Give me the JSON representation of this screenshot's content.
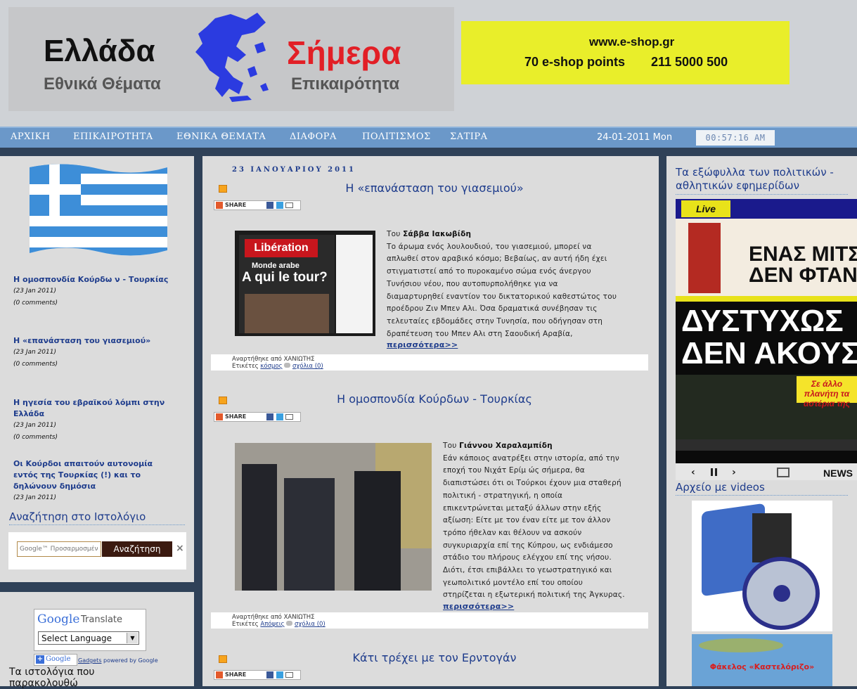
{
  "header": {
    "logo_word1": "Ελλάδα",
    "logo_word2": "Εθνικά Θέματα",
    "logo_word3": "Σήμερα",
    "logo_word4": "Επικαιρότητα",
    "ad_url": "www.e-shop.gr",
    "ad_points": "70 e-shop points",
    "ad_phone": "211 5000 500"
  },
  "nav": {
    "items": [
      "ΑΡΧΙΚΗ",
      "ΕΠΙΚΑΙΡΟΤΗΤΑ",
      "ΕΘΝΙΚΑ ΘΕΜΑΤΑ",
      "ΔΙΑΦΟΡΑ",
      "ΠΟΛΙΤΙΣΜΟΣ",
      "ΣΑΤΙΡΑ"
    ],
    "date": "24-01-2011  Mon",
    "clock": "00:57:16  AM"
  },
  "recent_posts": [
    {
      "title": "Η ομοσπονδία Κούρδω ν - Τουρκίας",
      "date": "(23 Jan 2011)",
      "comments": "(0 comments)"
    },
    {
      "title": "Η «επανάσταση του γιασεμιού»",
      "date": "(23 Jan 2011)",
      "comments": "(0 comments)"
    },
    {
      "title": "Η ηγεσία του εβραϊκού λόμπι στην Ελλάδα",
      "date": "(23 Jan 2011)",
      "comments": "(0 comments)"
    },
    {
      "title": "Οι Κούρδοι απαιτούν αυτονομία εντός της Τουρκίας (!) και το δηλώνουν δημόσια",
      "date": "(23 Jan 2011)"
    }
  ],
  "search_widget": {
    "title": "Αναζήτηση στο Ιστολόγιο",
    "placeholder": "Google™ Προσαρμοσμένη",
    "button": "Αναζήτηση",
    "close": "×"
  },
  "translate_widget": {
    "google": "Google",
    "translate": "Translate",
    "select": "Select Language",
    "gadgets": "Gadgets",
    "powered": "powered by Google"
  },
  "blogs_widget": {
    "title": "Τα ιστολόγια που παρακολουθώ"
  },
  "center": {
    "date_header": "23 ΙΑΝΟΥΑΡΙΟΥ 2011",
    "share_label": "SHARE",
    "posts": [
      {
        "title": "Η «επανάσταση του γιασεμιού»",
        "author_prefix": "Του ",
        "author": "Σάββα Ιακωβίδη",
        "lines": [
          "Το άρωμα ενός λουλουδιού, του γιασεμιού, μπορεί να",
          "απλωθεί στον αραβικό κόσμο; Βεβαίως, αν αυτή ήδη έχει",
          "στιγματιστεί από το πυροκαμένο σώμα ενός άνεργου",
          "Τυνήσιου νέου, που αυτοπυρπολήθηκε για να",
          "διαμαρτυρηθεί εναντίον του δικτατορικού καθεστώτος του",
          "προέδρου Ζιν Μπεν Αλι. Όσα δραματικά συνέβησαν τις",
          "τελευταίες εβδομάδες στην Τυνησία, που οδήγησαν στη",
          "δραπέτευση του Μπεν Αλι στη Σαουδική Αραβία,"
        ],
        "more": "περισσότερα>>",
        "posted_by": "Αναρτήθηκε από ΧΑΝΙΩΤΗΣ",
        "tags_label": "Ετικέτες",
        "tag": "κόσμος",
        "comments": "σχόλια (0)",
        "cover_title": "Libération",
        "cover_sub": "Monde arabe",
        "cover_head": "A qui le tour?"
      },
      {
        "title": "Η ομοσπονδία Κούρδων - Τουρκίας",
        "author_prefix": "Του ",
        "author": "Γιάννου Χαραλαμπίδη",
        "lines": [
          "Εάν κάποιος ανατρέξει στην ιστορία, από την",
          "εποχή του Νιχάτ Ερίμ ώς σήμερα, θα",
          "διαπιστώσει ότι οι Τούρκοι έχουν μια σταθερή",
          "πολιτική - στρατηγική, η οποία",
          "επικεντρώνεται μεταξύ άλλων στην εξής",
          "αξίωση: Είτε με τον έναν είτε με τον άλλον",
          "τρόπο ήθελαν και θέλουν να ασκούν",
          "συγκυριαρχία επί της Κύπρου, ως ενδιάμεσο",
          "στάδιο του πλήρους ελέγχου επί της νήσου.",
          "Διότι, έτσι επιβάλλει το γεωστρατηγικό και",
          "γεωπολιτικό μοντέλο επί του οποίου",
          "στηρίζεται η εξωτερική πολιτική της Άγκυρας."
        ],
        "more": "περισσότερα>>",
        "posted_by": "Αναρτήθηκε από ΧΑΝΙΩΤΗΣ",
        "tags_label": "Ετικέτες",
        "tag": "Απόψεις",
        "comments": "σχόλια (0)"
      },
      {
        "title": "Κάτι τρέχει με τον Ερντογάν"
      }
    ]
  },
  "right": {
    "covers_title": "Τα εξώφυλλα των πολιτικών - αθλητικών εφημερίδων",
    "cover_brand": "Live",
    "cover_head1": "ΕΝΑΣ ΜΙΤΣ",
    "cover_head1b": "ΔΕΝ ΦΤΑΝ",
    "cover_head2": "ΔΥΣΤΥΧΩΣ",
    "cover_head2b": "ΔΕΝ ΑΚΟΥΣΑ",
    "cover_red": "Σε άλλο πλανήτη τα αστέρια της",
    "cover_news": "NEWS",
    "videos_title": "Αρχείο με videos",
    "kastellorizo": "Φάκελος «Καστελόριζο»"
  }
}
